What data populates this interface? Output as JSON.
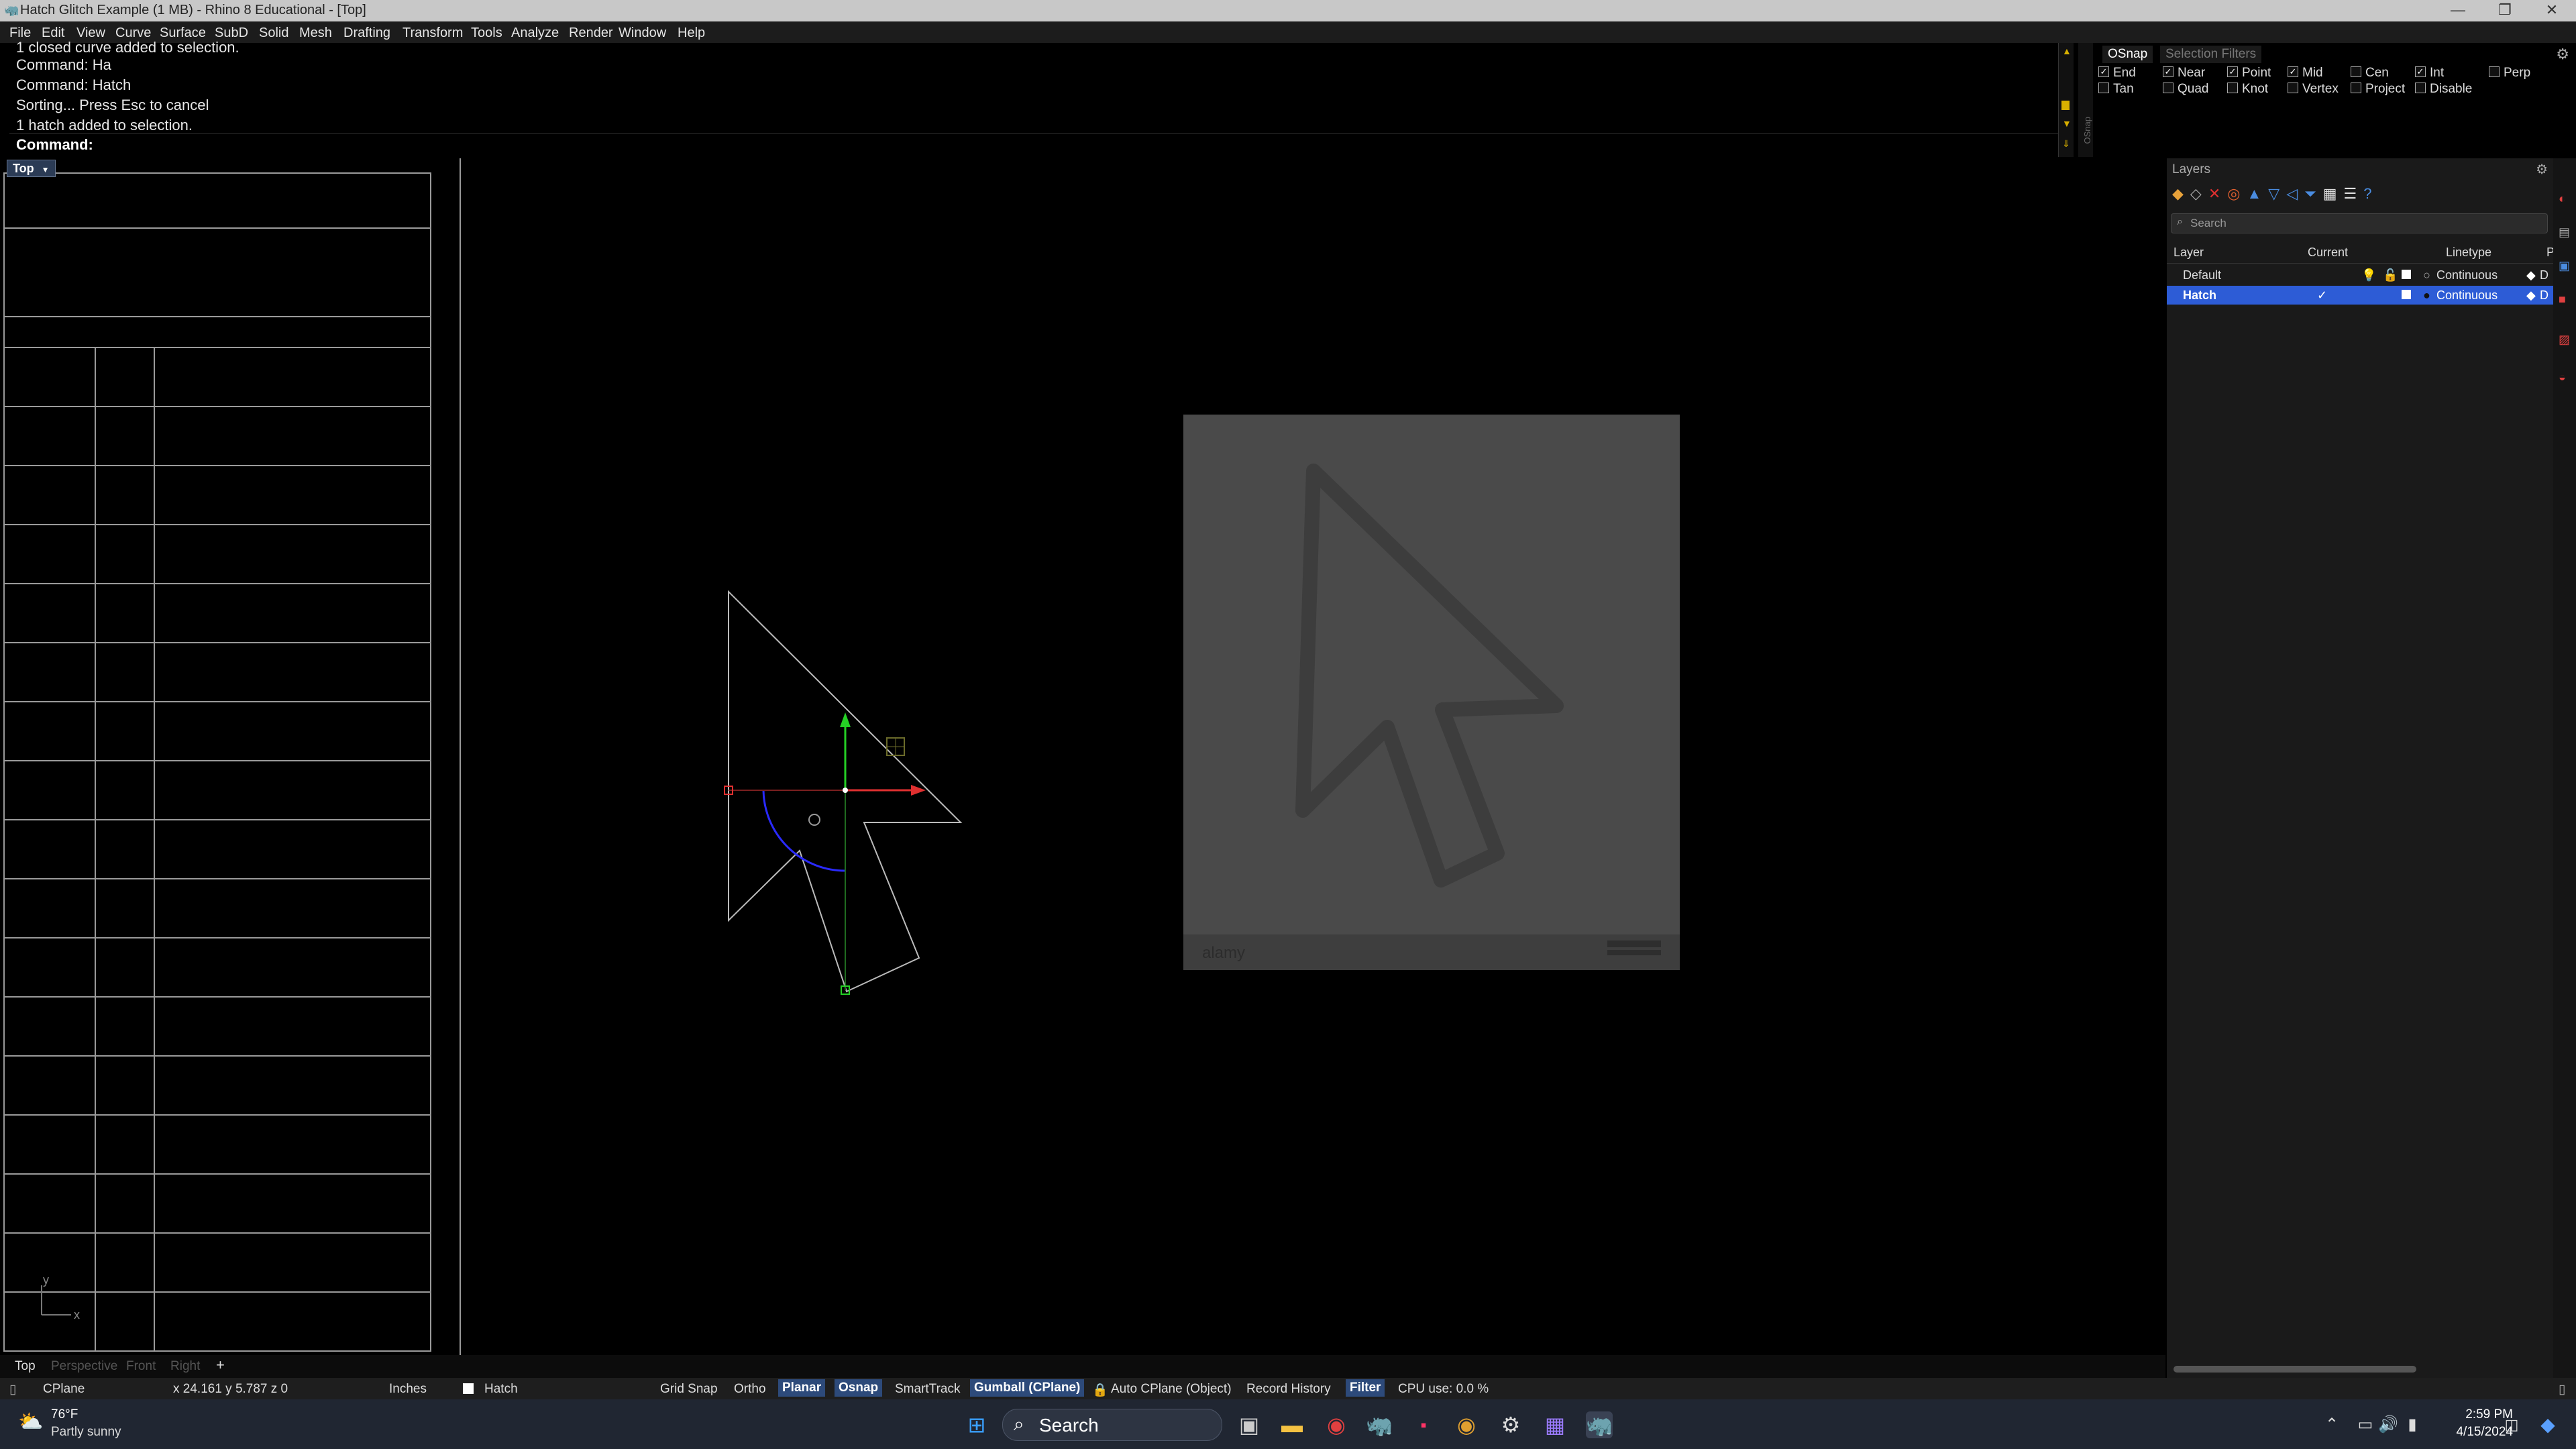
{
  "window": {
    "title": "Hatch Glitch Example (1 MB) - Rhino 8 Educational - [Top]",
    "controls": {
      "minimize": "—",
      "maximize": "❐",
      "close": "✕"
    }
  },
  "menu": [
    "File",
    "Edit",
    "View",
    "Curve",
    "Surface",
    "SubD",
    "Solid",
    "Mesh",
    "Drafting",
    "Transform",
    "Tools",
    "Analyze",
    "Render",
    "Window",
    "Help"
  ],
  "command_history": [
    "1 closed curve added to selection.",
    "Command: Ha",
    "Command: Hatch",
    "Sorting... Press Esc to cancel",
    "1 hatch added to selection."
  ],
  "command_prompt": "Command:",
  "osnap": {
    "tab_active": "OSnap",
    "tab_inactive": "Selection Filters",
    "side_label": "OSnap",
    "options": [
      {
        "label": "End",
        "checked": true
      },
      {
        "label": "Near",
        "checked": true
      },
      {
        "label": "Point",
        "checked": true
      },
      {
        "label": "Mid",
        "checked": true
      },
      {
        "label": "Cen",
        "checked": false
      },
      {
        "label": "Int",
        "checked": true
      },
      {
        "label": "Perp",
        "checked": false
      },
      {
        "label": "Tan",
        "checked": false
      },
      {
        "label": "Quad",
        "checked": false
      },
      {
        "label": "Knot",
        "checked": false
      },
      {
        "label": "Vertex",
        "checked": false
      },
      {
        "label": "Project",
        "checked": false
      },
      {
        "label": "Disable",
        "checked": false
      }
    ]
  },
  "viewport": {
    "name": "Top",
    "axis_x": "x",
    "axis_y": "y"
  },
  "layers": {
    "title": "Layers",
    "search_placeholder": "Search",
    "columns": {
      "layer": "Layer",
      "current": "Current",
      "linetype": "Linetype",
      "extra": "P"
    },
    "rows": [
      {
        "name": "Default",
        "current": "",
        "linetype": "Continuous",
        "extra": "D",
        "selected": false
      },
      {
        "name": "Hatch",
        "current": "✓",
        "linetype": "Continuous",
        "extra": "D",
        "selected": true
      }
    ]
  },
  "view_tabs": [
    "Top",
    "Perspective",
    "Front",
    "Right"
  ],
  "view_tabs_add": "+",
  "status": {
    "cplane": "CPlane",
    "coords": "x 24.161  y 5.787  z 0",
    "units": "Inches",
    "layer": "Hatch",
    "grid_snap": "Grid Snap",
    "ortho": "Ortho",
    "planar": "Planar",
    "osnap": "Osnap",
    "smarttrack": "SmartTrack",
    "gumball": "Gumball (CPlane)",
    "auto_cplane": "Auto CPlane (Object)",
    "record_history": "Record History",
    "filter": "Filter",
    "cpu": "CPU use: 0.0 %"
  },
  "taskbar": {
    "weather_temp": "76°F",
    "weather_desc": "Partly sunny",
    "search": "Search",
    "time": "2:59 PM",
    "date": "4/15/2024"
  },
  "reference_image": {
    "watermark_left": "alamy",
    "watermark_right": ""
  },
  "colors": {
    "accent": "#2d5cd6",
    "gumball_x": "#e03030",
    "gumball_y": "#25d025",
    "arc": "#2a2aff"
  }
}
